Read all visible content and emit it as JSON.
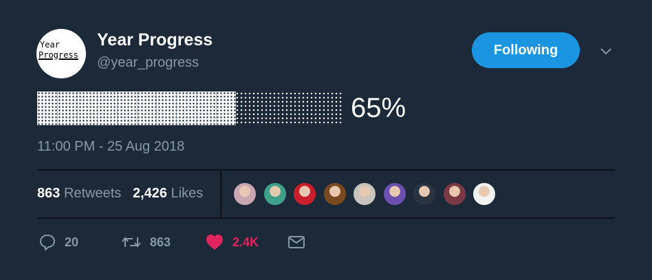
{
  "author": {
    "avatar_text_line1": "Year",
    "avatar_text_line2": "Progress",
    "display_name": "Year Progress",
    "handle": "@year_progress"
  },
  "follow_button": {
    "label": "Following",
    "color": "#1b95e0"
  },
  "tweet": {
    "progress_fraction": 0.65,
    "percent_text": "65%",
    "timestamp": "11:00 PM - 25 Aug 2018"
  },
  "stats": {
    "retweets_count": "863",
    "retweets_label": "Retweets",
    "likes_count": "2,426",
    "likes_label": "Likes"
  },
  "likers": [
    {
      "name": "liker-avatar-1",
      "color": "#c9a7b0"
    },
    {
      "name": "liker-avatar-2",
      "color": "#3fa08a"
    },
    {
      "name": "liker-avatar-3",
      "color": "#c8202b"
    },
    {
      "name": "liker-avatar-4",
      "color": "#7a4a1e"
    },
    {
      "name": "liker-avatar-5",
      "color": "#c9c3bd"
    },
    {
      "name": "liker-avatar-6",
      "color": "#6a4fb0"
    },
    {
      "name": "liker-avatar-7",
      "color": "#2a3440"
    },
    {
      "name": "liker-avatar-8",
      "color": "#7a3a44"
    },
    {
      "name": "liker-avatar-9",
      "color": "#f2f2f2"
    }
  ],
  "actions": {
    "reply_count": "20",
    "retweet_count": "863",
    "like_count": "2.4K"
  },
  "colors": {
    "background": "#1c2938",
    "secondary_text": "#8899a6",
    "like": "#e0245e"
  }
}
